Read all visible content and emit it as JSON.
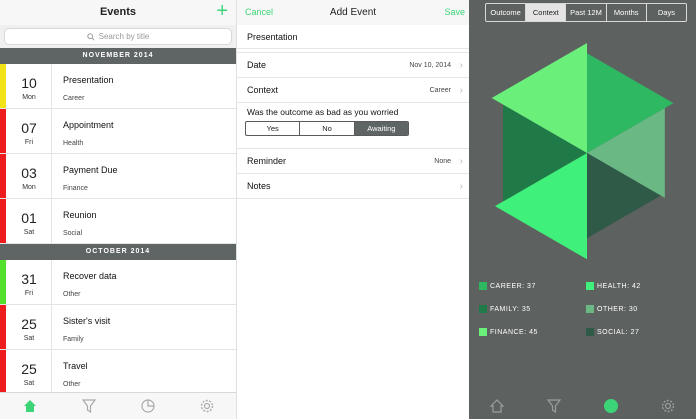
{
  "events_panel": {
    "title": "Events",
    "add_label": "+",
    "search_placeholder": "Search by title",
    "sections": [
      {
        "label": "NOVEMBER 2014",
        "events": [
          {
            "day": "10",
            "dow": "Mon",
            "title": "Presentation",
            "category": "Career",
            "color": "#f2e318"
          },
          {
            "day": "07",
            "dow": "Fri",
            "title": "Appointment",
            "category": "Health",
            "color": "#ee1c1c"
          },
          {
            "day": "03",
            "dow": "Mon",
            "title": "Payment Due",
            "category": "Finance",
            "color": "#ee1c1c"
          },
          {
            "day": "01",
            "dow": "Sat",
            "title": "Reunion",
            "category": "Social",
            "color": "#ee1c1c"
          }
        ]
      },
      {
        "label": "OCTOBER 2014",
        "events": [
          {
            "day": "31",
            "dow": "Fri",
            "title": "Recover data",
            "category": "Other",
            "color": "#52e02c"
          },
          {
            "day": "25",
            "dow": "Sat",
            "title": "Sister's visit",
            "category": "Family",
            "color": "#ee1c1c"
          },
          {
            "day": "25",
            "dow": "Sat",
            "title": "Travel",
            "category": "Other",
            "color": "#ee1c1c"
          }
        ]
      }
    ],
    "tabs": [
      "home-icon",
      "filter-icon",
      "pie-chart-icon",
      "settings-icon"
    ]
  },
  "add_event": {
    "title": "Add Event",
    "cancel_label": "Cancel",
    "save_label": "Save",
    "event_title": "Presentation",
    "date_label": "Date",
    "date_value": "Nov 10, 2014",
    "context_label": "Context",
    "context_value": "Career",
    "question": "Was the outcome as bad as you worried",
    "outcome_options": [
      "Yes",
      "No",
      "Awaiting"
    ],
    "outcome_selected": "Awaiting",
    "reminder_label": "Reminder",
    "reminder_value": "None",
    "notes_label": "Notes"
  },
  "chart_panel": {
    "segments": [
      "Outcome",
      "Context",
      "Past 12M",
      "Months",
      "Days"
    ],
    "selected_segment": "Context",
    "accent": "#3dd477",
    "tabs": [
      "home-icon",
      "filter-icon",
      "pie-chart-icon",
      "settings-icon"
    ]
  },
  "chart_data": {
    "type": "pie",
    "slices": [
      {
        "label": "Career",
        "value": 37,
        "color": "#2fb862"
      },
      {
        "label": "Other",
        "value": 30,
        "color": "#6ab884"
      },
      {
        "label": "Social",
        "value": 27,
        "color": "#2f5a48"
      },
      {
        "label": "Health",
        "value": 42,
        "color": "#3ff17a"
      },
      {
        "label": "Family",
        "value": 35,
        "color": "#1f7a48"
      },
      {
        "label": "Finance",
        "value": 45,
        "color": "#6bef7b"
      }
    ],
    "legend": [
      {
        "text": "CAREER: 37",
        "color": "#2fb862"
      },
      {
        "text": "HEALTH: 42",
        "color": "#3ff17a"
      },
      {
        "text": "FAMILY: 35",
        "color": "#1f7a48"
      },
      {
        "text": "OTHER: 30",
        "color": "#6ab884"
      },
      {
        "text": "FINANCE: 45",
        "color": "#6bef7b"
      },
      {
        "text": "SOCIAL: 27",
        "color": "#2f5a48"
      }
    ],
    "legend_placement": "bottom"
  }
}
